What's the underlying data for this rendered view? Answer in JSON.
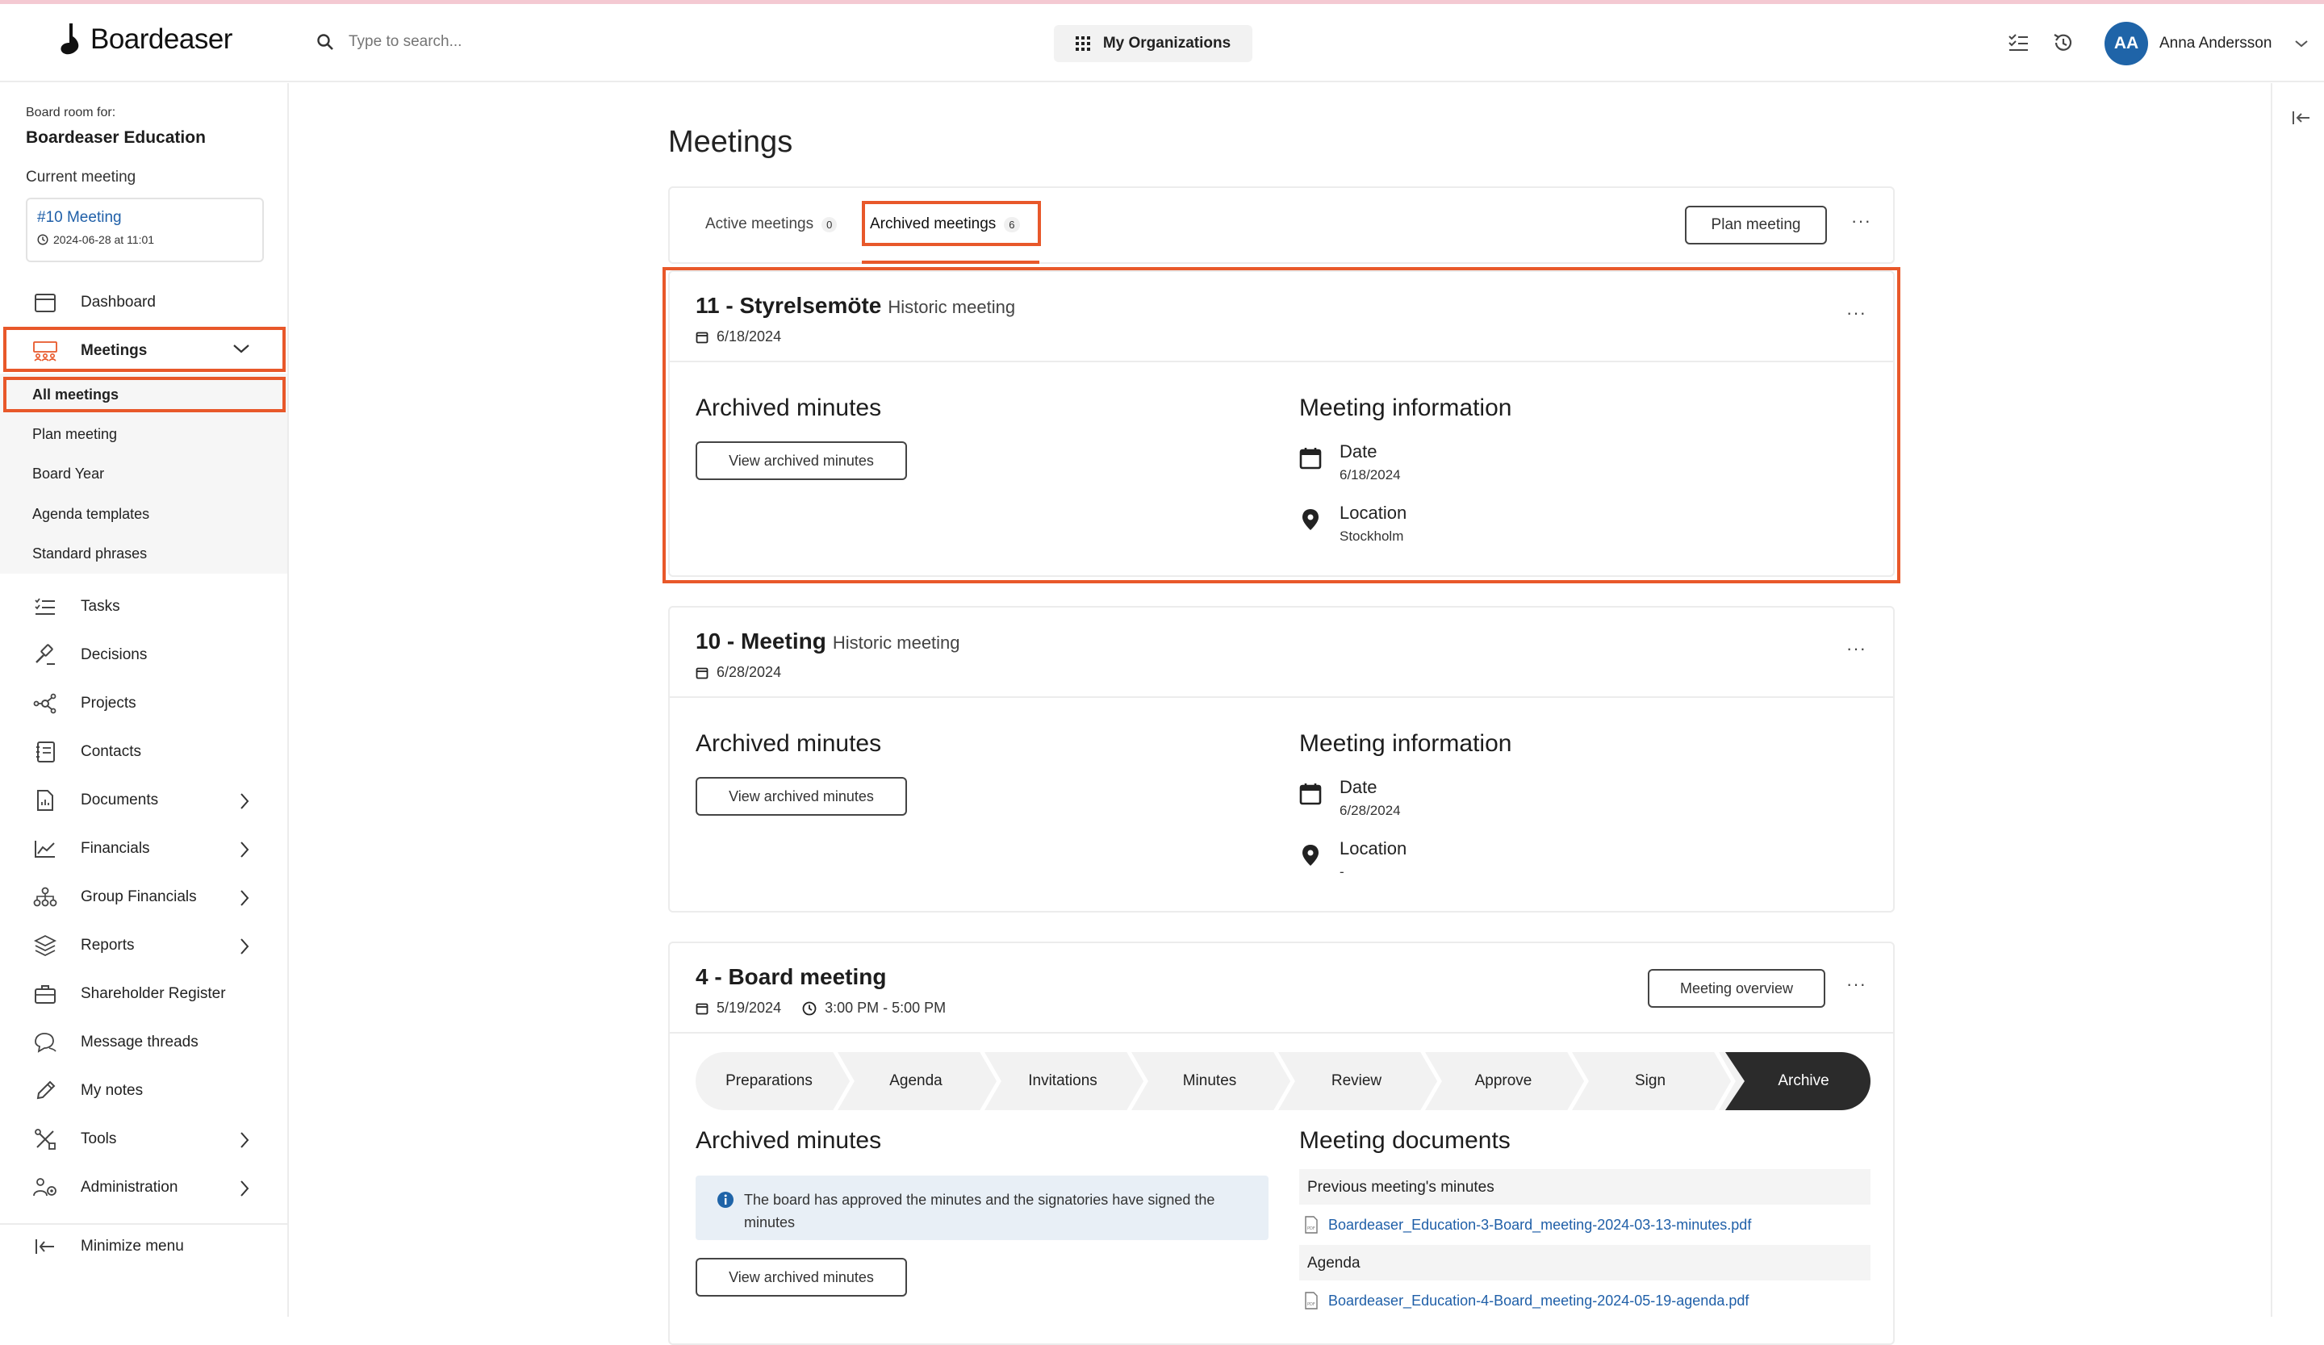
{
  "app": {
    "name": "Boardeaser"
  },
  "search": {
    "placeholder": "Type to search..."
  },
  "header": {
    "org_button": "My Organizations",
    "user_initials": "AA",
    "user_name": "Anna Andersson"
  },
  "sidebar": {
    "board_room_label": "Board room for:",
    "board_room_name": "Boardeaser Education",
    "current_meeting_label": "Current meeting",
    "current_meeting": {
      "title": "#10 Meeting",
      "date": "2024-06-28 at 11:01"
    },
    "items": [
      {
        "label": "Dashboard",
        "icon": "calendar-icon"
      },
      {
        "label": "Meetings",
        "icon": "meetings-icon",
        "expanded": true
      },
      {
        "label": "Tasks",
        "icon": "tasks-icon"
      },
      {
        "label": "Decisions",
        "icon": "gavel-icon"
      },
      {
        "label": "Projects",
        "icon": "projects-icon"
      },
      {
        "label": "Contacts",
        "icon": "contacts-icon"
      },
      {
        "label": "Documents",
        "icon": "document-icon",
        "has_children": true
      },
      {
        "label": "Financials",
        "icon": "chart-icon",
        "has_children": true
      },
      {
        "label": "Group Financials",
        "icon": "group-icon",
        "has_children": true
      },
      {
        "label": "Reports",
        "icon": "layers-icon",
        "has_children": true
      },
      {
        "label": "Shareholder Register",
        "icon": "briefcase-icon"
      },
      {
        "label": "Message threads",
        "icon": "chat-icon"
      },
      {
        "label": "My notes",
        "icon": "pencil-icon"
      },
      {
        "label": "Tools",
        "icon": "tools-icon",
        "has_children": true
      },
      {
        "label": "Administration",
        "icon": "admin-icon",
        "has_children": true
      }
    ],
    "submenu": [
      "All meetings",
      "Plan meeting",
      "Board Year",
      "Agenda templates",
      "Standard phrases"
    ],
    "minimize": "Minimize menu"
  },
  "main": {
    "title": "Meetings",
    "tabs": [
      {
        "label": "Active meetings",
        "count": "0"
      },
      {
        "label": "Archived meetings",
        "count": "6",
        "active": true
      }
    ],
    "plan_button": "Plan meeting",
    "meetings": [
      {
        "title": "11 - Styrelsemöte",
        "subtitle": "Historic meeting",
        "date": "6/18/2024",
        "archived_title": "Archived minutes",
        "view_button": "View archived minutes",
        "info_title": "Meeting information",
        "date_label": "Date",
        "date_value": "6/18/2024",
        "location_label": "Location",
        "location_value": "Stockholm"
      },
      {
        "title": "10 - Meeting",
        "subtitle": "Historic meeting",
        "date": "6/28/2024",
        "archived_title": "Archived minutes",
        "view_button": "View archived minutes",
        "info_title": "Meeting information",
        "date_label": "Date",
        "date_value": "6/28/2024",
        "location_label": "Location",
        "location_value": "-"
      },
      {
        "title": "4 - Board meeting",
        "date": "5/19/2024",
        "time": "3:00 PM - 5:00 PM",
        "overview_button": "Meeting overview",
        "steps": [
          "Preparations",
          "Agenda",
          "Invitations",
          "Minutes",
          "Review",
          "Approve",
          "Sign",
          "Archive"
        ],
        "archived_title": "Archived minutes",
        "alert": "The board has approved the minutes and the signatories have signed the minutes",
        "view_button": "View archived minutes",
        "docs_title": "Meeting documents",
        "doc_sections": [
          {
            "label": "Previous meeting's minutes",
            "file": "Boardeaser_Education-3-Board_meeting-2024-03-13-minutes.pdf"
          },
          {
            "label": "Agenda",
            "file": "Boardeaser_Education-4-Board_meeting-2024-05-19-agenda.pdf"
          }
        ]
      }
    ]
  },
  "colors": {
    "accent": "#e8582a",
    "link": "#1f5fa8",
    "avatar": "#1f64a8",
    "archive_step": "#2b2b2b"
  }
}
